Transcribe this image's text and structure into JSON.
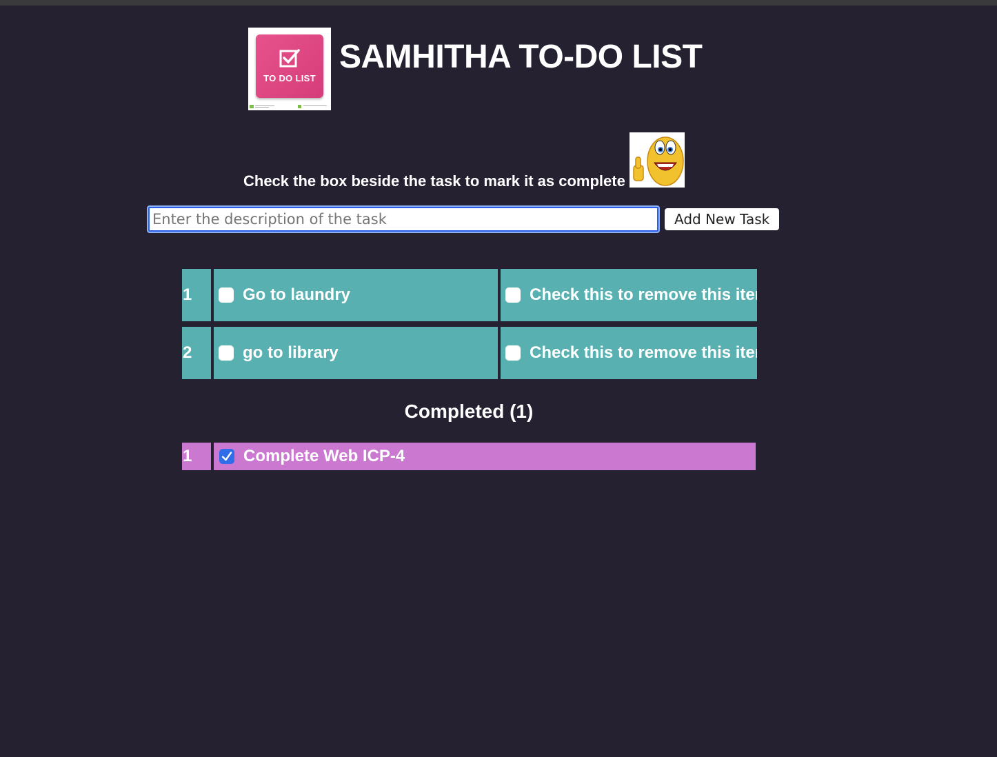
{
  "header": {
    "logo_text": "TO DO LIST",
    "title": "SAMHITHA TO-DO LIST"
  },
  "instruction": "Check the box beside the task to mark it as complete",
  "add_task": {
    "placeholder": "Enter the description of the task",
    "value": "",
    "button_label": "Add New Task"
  },
  "tasks": [
    {
      "number": "1",
      "description": "Go to laundry",
      "done": false,
      "remove_label": "Check this to remove this item"
    },
    {
      "number": "2",
      "description": "go to library",
      "done": false,
      "remove_label": "Check this to remove this item"
    }
  ],
  "completed": {
    "heading": "Completed (1)",
    "items": [
      {
        "number": "1",
        "description": "Complete Web ICP-4",
        "done": true
      }
    ]
  },
  "colors": {
    "background": "#252131",
    "task_row": "#58b0b1",
    "completed_row": "#ca78d0",
    "checkbox_checked": "#2f6ee8",
    "logo": "#e8528c"
  },
  "icons": {
    "logo": "todo-list-logo-icon",
    "smiley": "thumbs-up-smiley-icon",
    "checkmark": "checkmark-icon"
  }
}
